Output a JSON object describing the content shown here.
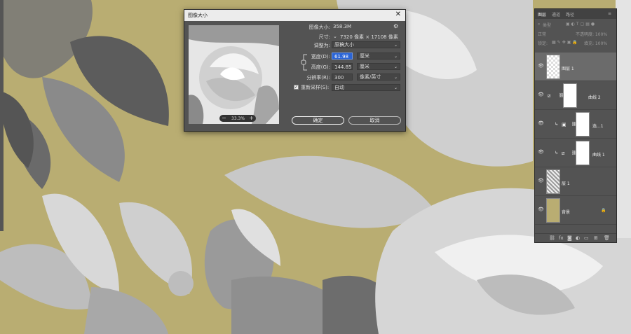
{
  "dialog": {
    "title": "图像大小",
    "close": "✕",
    "image_size_label": "图像大小:",
    "image_size_value": "358.3M",
    "dimensions_label": "尺寸:",
    "dimensions_value": "7320 像素 × 17108 像素",
    "fit_label": "调整为:",
    "fit_value": "原稿大小",
    "width_label": "宽度(D):",
    "width_value": "61.98",
    "width_unit": "厘米",
    "height_label": "高度(G):",
    "height_value": "144.85",
    "height_unit": "厘米",
    "resolution_label": "分辨率(R):",
    "resolution_value": "300",
    "resolution_unit": "像素/英寸",
    "resample_label": "重新采样(S):",
    "resample_value": "自动",
    "resample_checked": "✓",
    "ok_label": "确定",
    "cancel_label": "取消",
    "zoom_value": "33.3%",
    "zoom_minus": "−",
    "zoom_plus": "+"
  },
  "panel": {
    "tabs": [
      "图层",
      "通道",
      "路径"
    ],
    "kind_label": "类型",
    "mode_label": "正常",
    "opacity_label": "不透明度: 100%",
    "lock_label": "锁定:",
    "fill_label": "填充: 100%",
    "layers": [
      {
        "name": "图层 1"
      },
      {
        "name": "曲线 2"
      },
      {
        "name": "选...1"
      },
      {
        "name": "曲线 1"
      },
      {
        "name": "层 1"
      },
      {
        "name": "背景"
      }
    ]
  },
  "colors": {
    "canvas_bg": "#b9ad72",
    "dialog_bg": "#535353",
    "selection": "#2a64d6"
  }
}
